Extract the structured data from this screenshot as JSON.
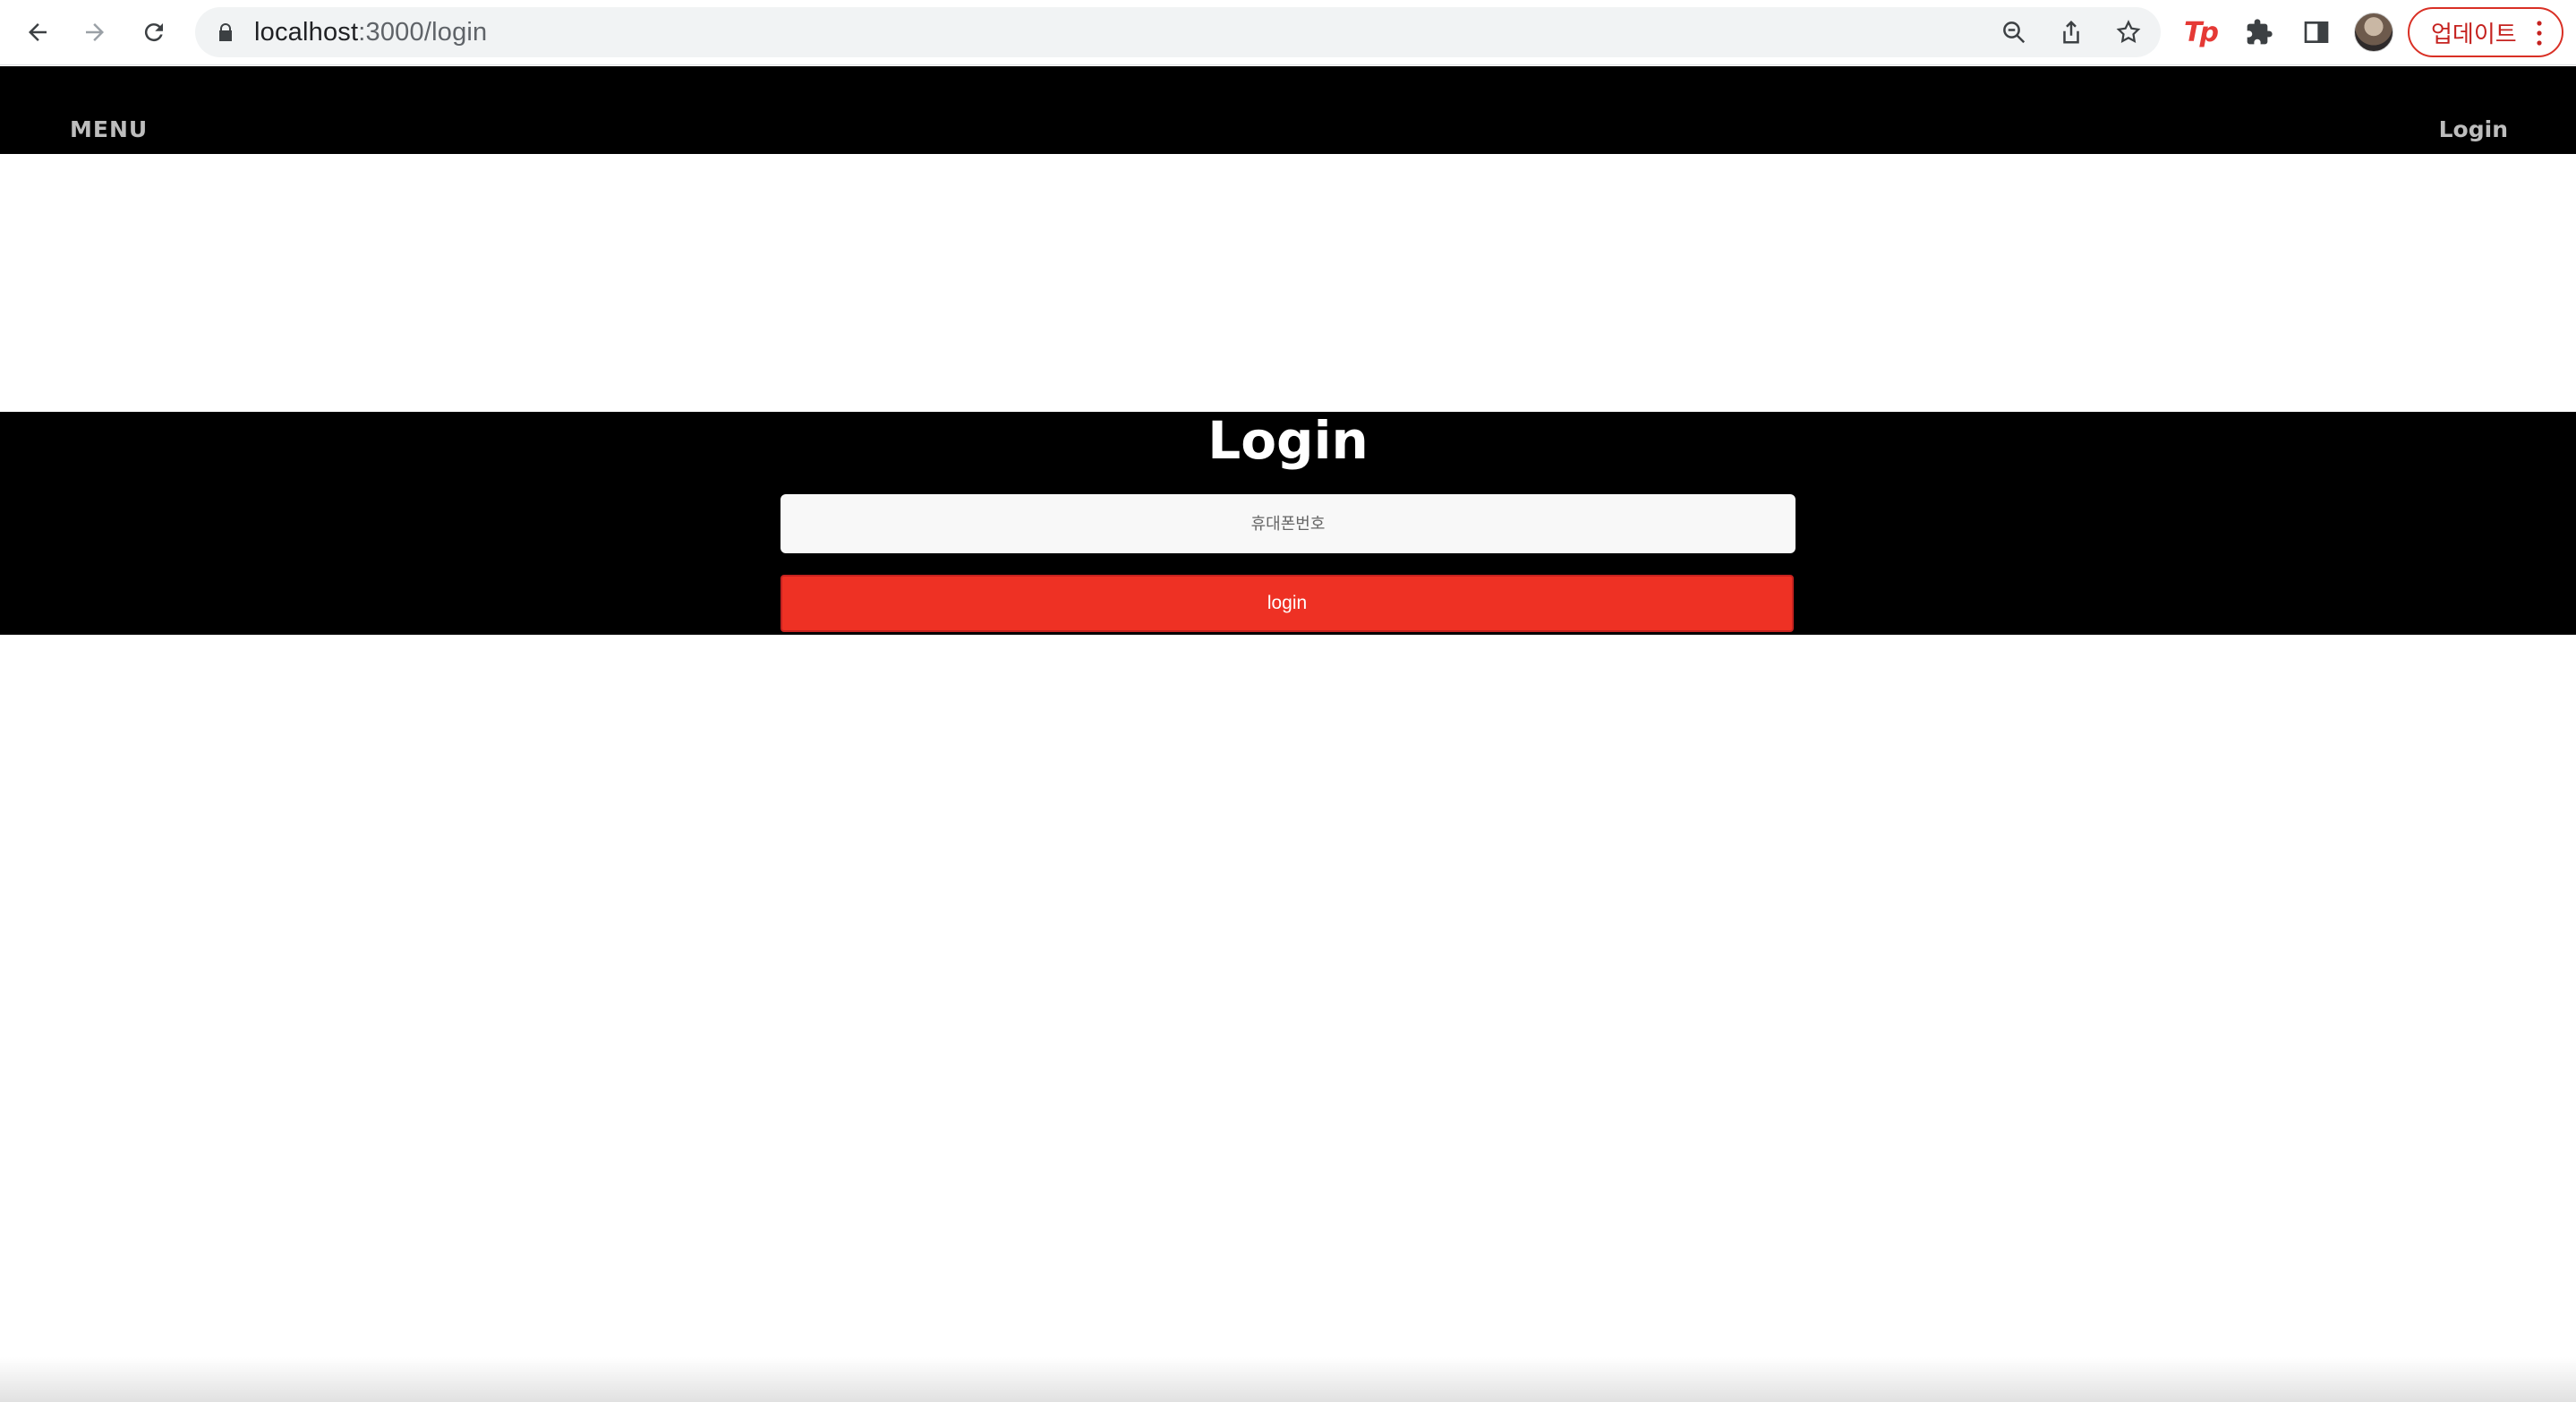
{
  "browser": {
    "url_host": "localhost",
    "url_path": ":3000/login",
    "update_label": "업데이트",
    "extension_label": "Tp"
  },
  "header": {
    "menu_label": "MENU",
    "login_label": "Login"
  },
  "login": {
    "title": "Login",
    "phone_placeholder": "휴대폰번호",
    "submit_label": "login"
  },
  "colors": {
    "header_bg": "#000000",
    "button_bg": "#ee3124",
    "update_accent": "#d93025"
  }
}
